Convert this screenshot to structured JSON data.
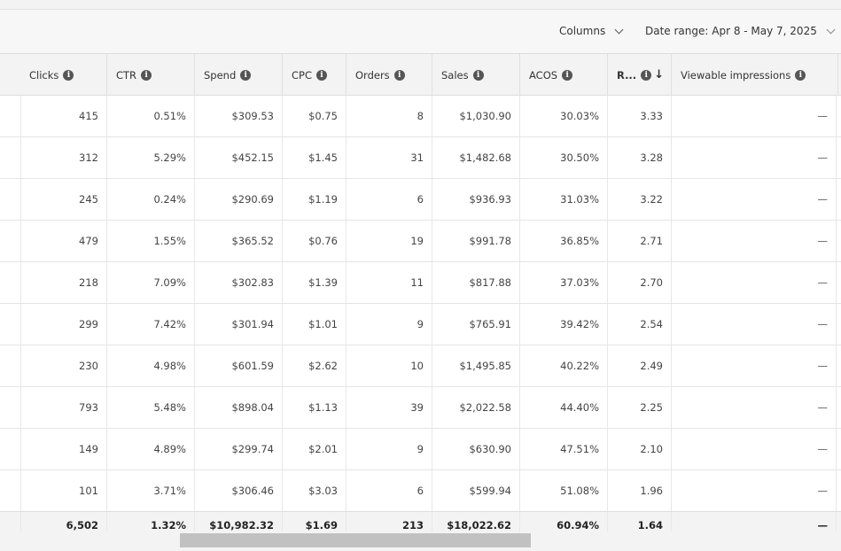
{
  "toolbar": {
    "columns_label": "Columns",
    "date_range_label": "Date range: Apr 8 - May 7, 2025"
  },
  "columns": [
    {
      "label": "Clicks",
      "info": true,
      "sort": ""
    },
    {
      "label": "CTR",
      "info": true,
      "sort": ""
    },
    {
      "label": "Spend",
      "info": true,
      "sort": ""
    },
    {
      "label": "CPC",
      "info": true,
      "sort": ""
    },
    {
      "label": "Orders",
      "info": true,
      "sort": ""
    },
    {
      "label": "Sales",
      "info": true,
      "sort": ""
    },
    {
      "label": "ACOS",
      "info": true,
      "sort": ""
    },
    {
      "label": "R...",
      "info": true,
      "sort": "↓"
    },
    {
      "label": "Viewable impressions",
      "info": true,
      "sort": ""
    }
  ],
  "rows": [
    [
      "415",
      "0.51%",
      "$309.53",
      "$0.75",
      "8",
      "$1,030.90",
      "30.03%",
      "3.33",
      "—"
    ],
    [
      "312",
      "5.29%",
      "$452.15",
      "$1.45",
      "31",
      "$1,482.68",
      "30.50%",
      "3.28",
      "—"
    ],
    [
      "245",
      "0.24%",
      "$290.69",
      "$1.19",
      "6",
      "$936.93",
      "31.03%",
      "3.22",
      "—"
    ],
    [
      "479",
      "1.55%",
      "$365.52",
      "$0.76",
      "19",
      "$991.78",
      "36.85%",
      "2.71",
      "—"
    ],
    [
      "218",
      "7.09%",
      "$302.83",
      "$1.39",
      "11",
      "$817.88",
      "37.03%",
      "2.70",
      "—"
    ],
    [
      "299",
      "7.42%",
      "$301.94",
      "$1.01",
      "9",
      "$765.91",
      "39.42%",
      "2.54",
      "—"
    ],
    [
      "230",
      "4.98%",
      "$601.59",
      "$2.62",
      "10",
      "$1,495.85",
      "40.22%",
      "2.49",
      "—"
    ],
    [
      "793",
      "5.48%",
      "$898.04",
      "$1.13",
      "39",
      "$2,022.58",
      "44.40%",
      "2.25",
      "—"
    ],
    [
      "149",
      "4.89%",
      "$299.74",
      "$2.01",
      "9",
      "$630.90",
      "47.51%",
      "2.10",
      "—"
    ],
    [
      "101",
      "3.71%",
      "$306.46",
      "$3.03",
      "6",
      "$599.94",
      "51.08%",
      "1.96",
      "—"
    ]
  ],
  "totals": [
    "6,502",
    "1.32%",
    "$10,982.32",
    "$1.69",
    "213",
    "$18,022.62",
    "60.94%",
    "1.64",
    "—"
  ]
}
